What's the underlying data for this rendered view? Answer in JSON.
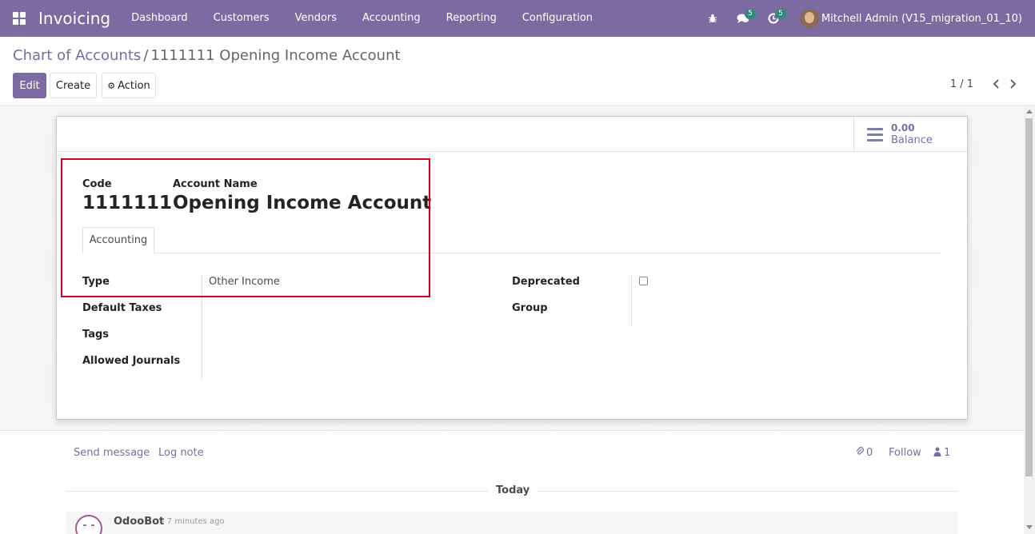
{
  "navbar": {
    "app_name": "Invoicing",
    "menu": [
      {
        "label": "Dashboard"
      },
      {
        "label": "Customers"
      },
      {
        "label": "Vendors"
      },
      {
        "label": "Accounting"
      },
      {
        "label": "Reporting"
      },
      {
        "label": "Configuration"
      }
    ],
    "messages_badge": "5",
    "activities_badge": "5",
    "user_name": "Mitchell Admin (V15_migration_01_10)",
    "bar_color": "#7c6ba1",
    "icons": {
      "apps": "apps-grid-icon",
      "debug": "bug-icon",
      "messages": "chat-bubbles-icon",
      "activities": "clock-icon"
    }
  },
  "breadcrumb": {
    "parent": "Chart of Accounts",
    "separator": "/",
    "current": "1111111 Opening Income Account"
  },
  "buttons": {
    "edit": "Edit",
    "create": "Create",
    "action": "Action"
  },
  "pager": {
    "value": "1 / 1"
  },
  "stat": {
    "value": "0.00",
    "label": "Balance"
  },
  "form": {
    "code_label": "Code",
    "code_value": "1111111",
    "name_label": "Account Name",
    "name_value": "Opening Income Account",
    "tab_label": "Accounting",
    "left_fields": [
      {
        "label": "Type",
        "value": "Other Income"
      },
      {
        "label": "Default Taxes",
        "value": ""
      },
      {
        "label": "Tags",
        "value": ""
      },
      {
        "label": "Allowed Journals",
        "value": ""
      }
    ],
    "right_fields": [
      {
        "label": "Deprecated",
        "checked": false
      },
      {
        "label": "Group",
        "value": ""
      }
    ]
  },
  "chatter": {
    "send_message": "Send message",
    "log_note": "Log note",
    "attachments_count": "0",
    "follow": "Follow",
    "followers_count": "1",
    "today": "Today",
    "message_author": "OdooBot",
    "message_time": "- 7 minutes ago"
  },
  "highlight_color": "#d0021b"
}
